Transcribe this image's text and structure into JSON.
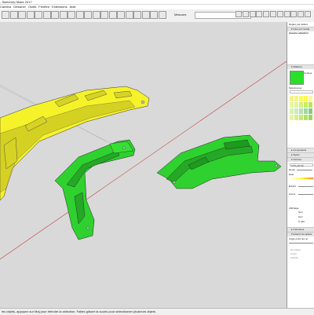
{
  "app": {
    "title": "- SketchUp Make 2017"
  },
  "menu": [
    "Caméra",
    "Dessiner",
    "Outils",
    "Fenêtre",
    "Extensions",
    "Aide"
  ],
  "toolbar": {
    "icons": [
      "select-icon",
      "eraser-icon",
      "pencil-icon",
      "arc-icon",
      "rectangle-icon",
      "push-pull-icon",
      "move-icon",
      "rotate-icon",
      "scale-icon",
      "offset-icon",
      "tape-icon",
      "text-icon",
      "axes-icon",
      "dimension-icon",
      "protractor-icon",
      "paint-icon",
      "orbit-icon",
      "pan-icon",
      "zoom-icon",
      "zoom-window-icon",
      "zoom-extents-icon",
      "warehouse-icon",
      "extension-icon",
      "layout-icon",
      "home-icon",
      "prev-icon",
      "next-icon",
      "paint2-icon",
      "house-icon",
      "add-location-icon",
      "terrain-icon"
    ],
    "measure_label": "Mesures"
  },
  "panel": {
    "title": "Réglés par défaut",
    "entity_info": "▾ Infos sur l'entité",
    "selection_note": "Aucune sélection",
    "materials_header": "▾ Matières",
    "material_name": "Couleur",
    "tab_select": "Sélectionner",
    "row_name": "Nom",
    "row_color": "Couleur",
    "components_header": "▸ Composants",
    "styles_header": "▸ Styles",
    "shadows_header": "▾ Ombres",
    "utc": "UTC+01:00",
    "heure": "Heure",
    "date": "Date",
    "eclaire": "Éclairé",
    "fonce": "Foncé",
    "affichage": "Affichage",
    "sur_faces": "Sur l",
    "sur_sol": "Sur l",
    "a_partir": "À part",
    "instructor_header": "▸ Instructeur",
    "soften_header": "▾ Adoucir les arêtes",
    "angle_label": "Angle entre les no",
    "normals": "Normales",
    "smooth": "Lisser",
    "soften_coplanar": "Adoucir"
  },
  "status": {
    "text": "les objets, appuyez sur Maj pour étendre la sélection. Faites glisser la souris pour sélectionner plusieurs objets."
  },
  "colors": {
    "yellow": "#f5f22a",
    "green": "#2fd12f",
    "accent": "#28e028",
    "red_axis": "#c04040"
  }
}
